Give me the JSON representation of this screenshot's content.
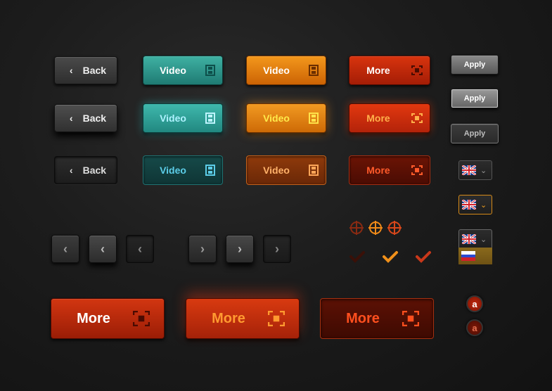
{
  "back_buttons": [
    {
      "label": "Back",
      "state": "normal"
    },
    {
      "label": "Back",
      "state": "hover"
    },
    {
      "label": "Back",
      "state": "pressed"
    }
  ],
  "video_teal_buttons": [
    {
      "label": "Video",
      "state": "normal"
    },
    {
      "label": "Video",
      "state": "hover"
    },
    {
      "label": "Video",
      "state": "pressed"
    }
  ],
  "video_orange_buttons": [
    {
      "label": "Video",
      "state": "normal"
    },
    {
      "label": "Video",
      "state": "hover"
    },
    {
      "label": "Video",
      "state": "pressed"
    }
  ],
  "more_buttons": [
    {
      "label": "More",
      "state": "normal"
    },
    {
      "label": "More",
      "state": "hover"
    },
    {
      "label": "More",
      "state": "pressed"
    }
  ],
  "apply_buttons": [
    {
      "label": "Apply",
      "state": "normal"
    },
    {
      "label": "Apply",
      "state": "hover"
    },
    {
      "label": "Apply",
      "state": "pressed"
    }
  ],
  "big_more_buttons": [
    {
      "label": "More",
      "state": "normal"
    },
    {
      "label": "More",
      "state": "hover"
    },
    {
      "label": "More",
      "state": "pressed"
    }
  ],
  "nav_buttons": {
    "prev_icon": "chevron-left-icon",
    "next_icon": "chevron-right-icon"
  },
  "language_selector": {
    "selected_flag": "uk-flag-icon",
    "options": [
      "uk-flag-icon",
      "russia-flag-icon"
    ]
  },
  "icons": {
    "radio": "radio-target-icon",
    "check": "checkmark-icon",
    "avatar_badge": "a"
  },
  "colors": {
    "teal": "#2a9a8f",
    "orange": "#e47a10",
    "red": "#c02a0b",
    "gray": "#6e6e6e"
  }
}
